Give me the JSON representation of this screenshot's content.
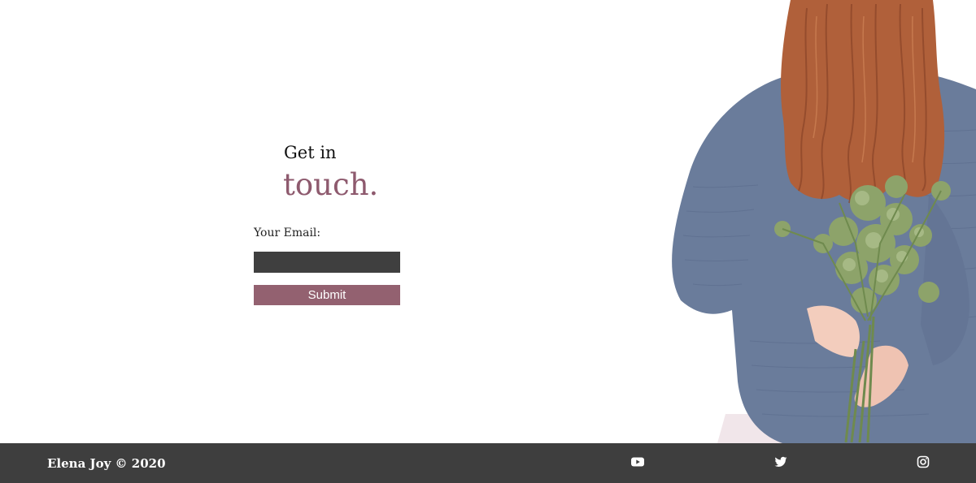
{
  "contact": {
    "heading_small": "Get in",
    "heading_large": "touch.",
    "email_label": "Your Email:",
    "email_value": "",
    "email_placeholder": "",
    "submit_label": "Submit"
  },
  "footer": {
    "copyright": "Elena Joy © 2020",
    "social": [
      {
        "icon": "youtube-icon"
      },
      {
        "icon": "twitter-icon"
      },
      {
        "icon": "instagram-icon"
      }
    ]
  },
  "colors": {
    "accent": "#936170",
    "heading_accent": "#8e5a6e",
    "input_bg": "#3f3f3f",
    "footer_bg": "#3e3e3e",
    "page_bg": "#ffffff"
  }
}
